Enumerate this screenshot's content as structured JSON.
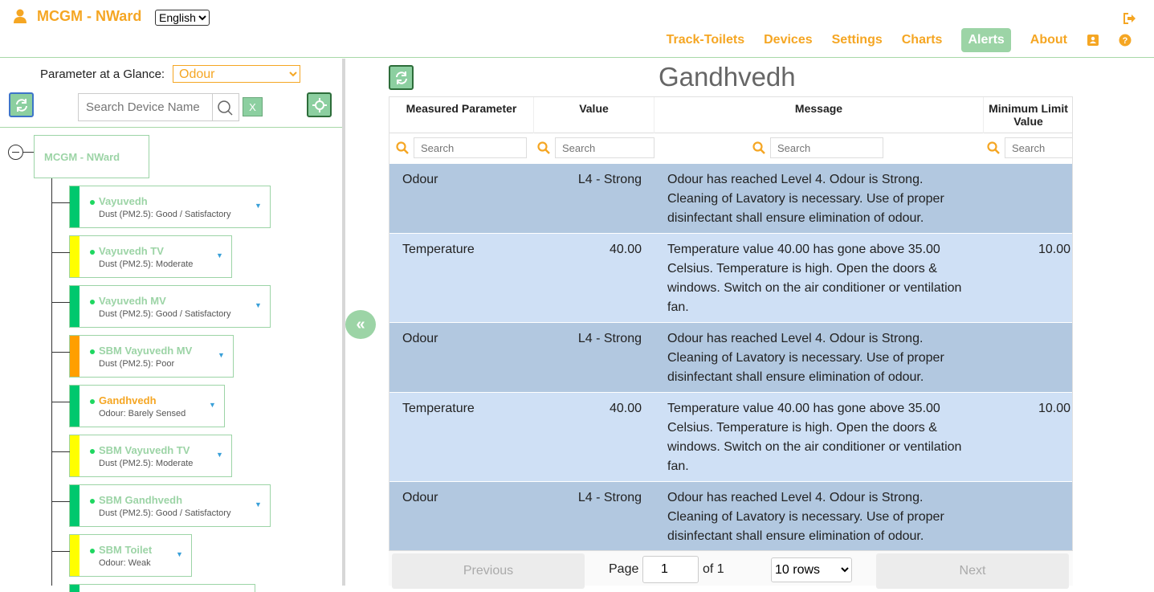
{
  "header": {
    "app_title": "MCGM - NWard",
    "language": "English",
    "nav": [
      {
        "label": "Track-Toilets",
        "active": false
      },
      {
        "label": "Devices",
        "active": false
      },
      {
        "label": "Settings",
        "active": false
      },
      {
        "label": "Charts",
        "active": false
      },
      {
        "label": "Alerts",
        "active": true
      },
      {
        "label": "About",
        "active": false
      }
    ],
    "accent_color": "#f5a623",
    "active_nav_color": "#9cd4a6"
  },
  "sidebar": {
    "parameter_label": "Parameter at a Glance:",
    "parameter_value": "Odour",
    "search_placeholder": "Search Device Name",
    "clear_label": "X",
    "root_label": "MCGM - NWard",
    "devices": [
      {
        "name": "Vayuvedh",
        "status": "Dust (PM2.5): Good / Satisfactory",
        "color": "#00c86e",
        "selected": false
      },
      {
        "name": "Vayuvedh TV",
        "status": "Dust (PM2.5): Moderate",
        "color": "#ffff00",
        "selected": false
      },
      {
        "name": "Vayuvedh MV",
        "status": "Dust (PM2.5): Good / Satisfactory",
        "color": "#00c86e",
        "selected": false
      },
      {
        "name": "SBM Vayuvedh MV",
        "status": "Dust (PM2.5): Poor",
        "color": "#ff9f00",
        "selected": false
      },
      {
        "name": "Gandhvedh",
        "status": "Odour: Barely Sensed",
        "color": "#00c86e",
        "selected": true
      },
      {
        "name": "SBM Vayuvedh TV",
        "status": "Dust (PM2.5): Moderate",
        "color": "#ffff00",
        "selected": false
      },
      {
        "name": "SBM Gandhvedh",
        "status": "Dust (PM2.5): Good / Satisfactory",
        "color": "#00c86e",
        "selected": false
      },
      {
        "name": "SBM Toilet",
        "status": "Odour: Weak",
        "color": "#ffff00",
        "selected": false
      }
    ]
  },
  "main": {
    "device_title": "Gandhvedh",
    "columns": [
      "Measured Parameter",
      "Value",
      "Message",
      "Minimum Limit Value"
    ],
    "filter_placeholder": "Search",
    "rows": [
      {
        "param": "Odour",
        "value": "L4 - Strong",
        "message": "Odour has reached Level 4. Odour is Strong. Cleaning of Lavatory is necessary. Use of proper disinfectant shall ensure elimination of odour.",
        "min": ""
      },
      {
        "param": "Temperature",
        "value": "40.00",
        "message": "Temperature value 40.00 has gone above 35.00 Celsius. Temperature is high. Open the doors & windows. Switch on the air conditioner or ventilation fan.",
        "min": "10.00"
      },
      {
        "param": "Odour",
        "value": "L4 - Strong",
        "message": "Odour has reached Level 4. Odour is Strong. Cleaning of Lavatory is necessary. Use of proper disinfectant shall ensure elimination of odour.",
        "min": ""
      },
      {
        "param": "Temperature",
        "value": "40.00",
        "message": "Temperature value 40.00 has gone above 35.00 Celsius. Temperature is high. Open the doors & windows. Switch on the air conditioner or ventilation fan.",
        "min": "10.00"
      },
      {
        "param": "Odour",
        "value": "L4 - Strong",
        "message": "Odour has reached Level 4. Odour is Strong. Cleaning of Lavatory is necessary. Use of proper disinfectant shall ensure elimination of odour.",
        "min": ""
      }
    ],
    "pagination": {
      "previous_label": "Previous",
      "page_label": "Page",
      "current_page": "1",
      "of_label": "of 1",
      "rows_option": "10 rows",
      "next_label": "Next"
    }
  }
}
